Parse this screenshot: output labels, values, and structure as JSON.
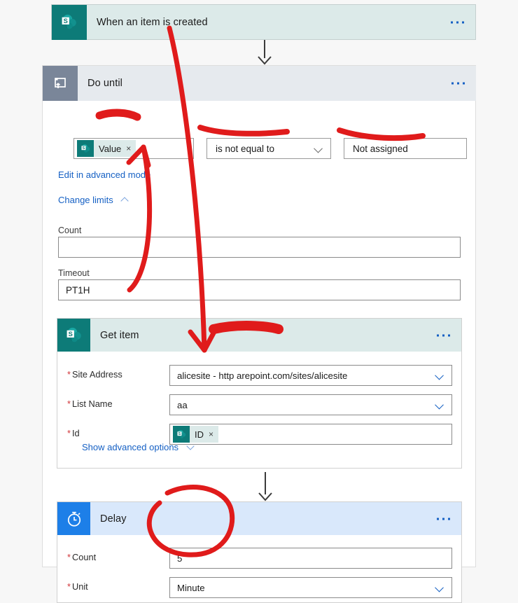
{
  "trigger": {
    "title": "When an item is created",
    "icon": "sharepoint-icon",
    "overflow": "more-commands"
  },
  "scope": {
    "title": "Do until",
    "icon": "loop-icon",
    "condition": {
      "token_label": "Value",
      "token_icon": "sharepoint-icon",
      "token_remove": "×",
      "operator": "is not equal to",
      "value": "Not assigned"
    },
    "links": {
      "advanced": "Edit in advanced mode",
      "limits": "Change limits"
    },
    "limits": {
      "count_label": "Count",
      "count_value": "",
      "timeout_label": "Timeout",
      "timeout_value": "PT1H"
    }
  },
  "get_item": {
    "title": "Get item",
    "icon": "sharepoint-icon",
    "fields": [
      {
        "label": "Site Address",
        "required": true,
        "value": "alicesite - http          arepoint.com/sites/alicesite",
        "has_dropdown": true
      },
      {
        "label": "List Name",
        "required": true,
        "value": "aa",
        "has_dropdown": true
      },
      {
        "label": "Id",
        "required": true,
        "value": "",
        "token": "ID",
        "token_remove": "×",
        "has_dropdown": false
      }
    ],
    "advanced_link": "Show advanced options"
  },
  "delay": {
    "title": "Delay",
    "icon": "stopwatch-icon",
    "fields": [
      {
        "label": "Count",
        "required": true,
        "value": "5",
        "has_dropdown": false
      },
      {
        "label": "Unit",
        "required": true,
        "value": "Minute",
        "has_dropdown": true
      }
    ]
  },
  "colors": {
    "sharepoint_teal": "#0d7b78",
    "sharepoint_header": "#dceae9",
    "loop_gray": "#7a8699",
    "loop_header": "#e6eaee",
    "delay_blue": "#1d7fe8",
    "delay_header": "#d9e8fb",
    "link_blue": "#1560c4",
    "required_red": "#d13438",
    "annotation_red": "#e01b1b",
    "canvas_bg": "#f7f7f7"
  }
}
